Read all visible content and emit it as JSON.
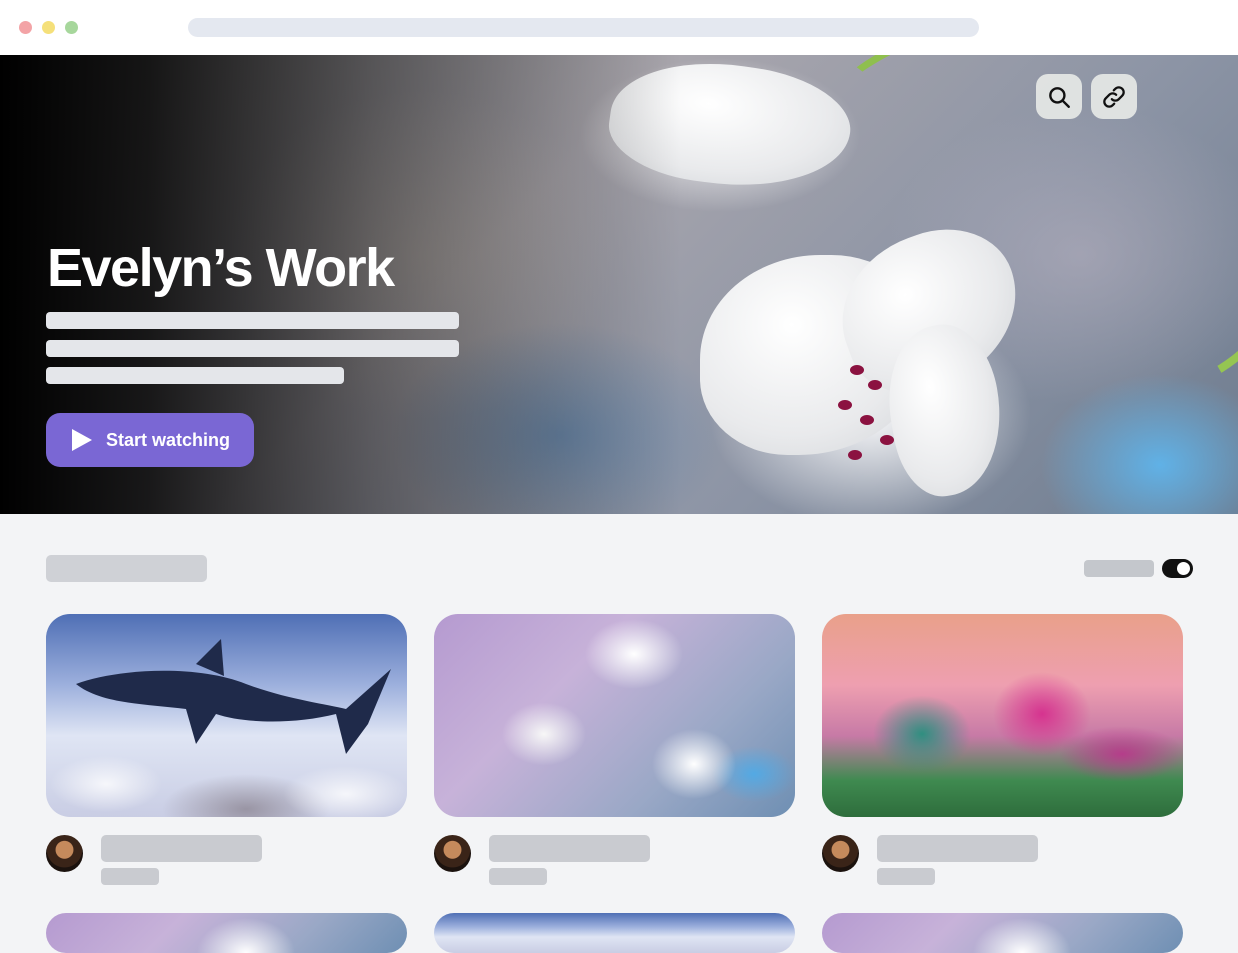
{
  "window": {
    "address_bar": ""
  },
  "hero": {
    "title": "Evelyn’s Work",
    "cta_label": "Start watching",
    "actions": [
      {
        "name": "search",
        "icon": "search-icon"
      },
      {
        "name": "copy-link",
        "icon": "link-icon"
      }
    ]
  },
  "colors": {
    "accent": "#7a67d4",
    "background": "#f3f4f6",
    "skeleton": "#c9cbd0"
  },
  "gallery": {
    "layout_toggle_on": true,
    "cards": [
      {
        "thumbnail": "whale-in-clouds"
      },
      {
        "thumbnail": "white-orchids-in-water"
      },
      {
        "thumbnail": "pink-fantasy-jungle"
      }
    ]
  }
}
